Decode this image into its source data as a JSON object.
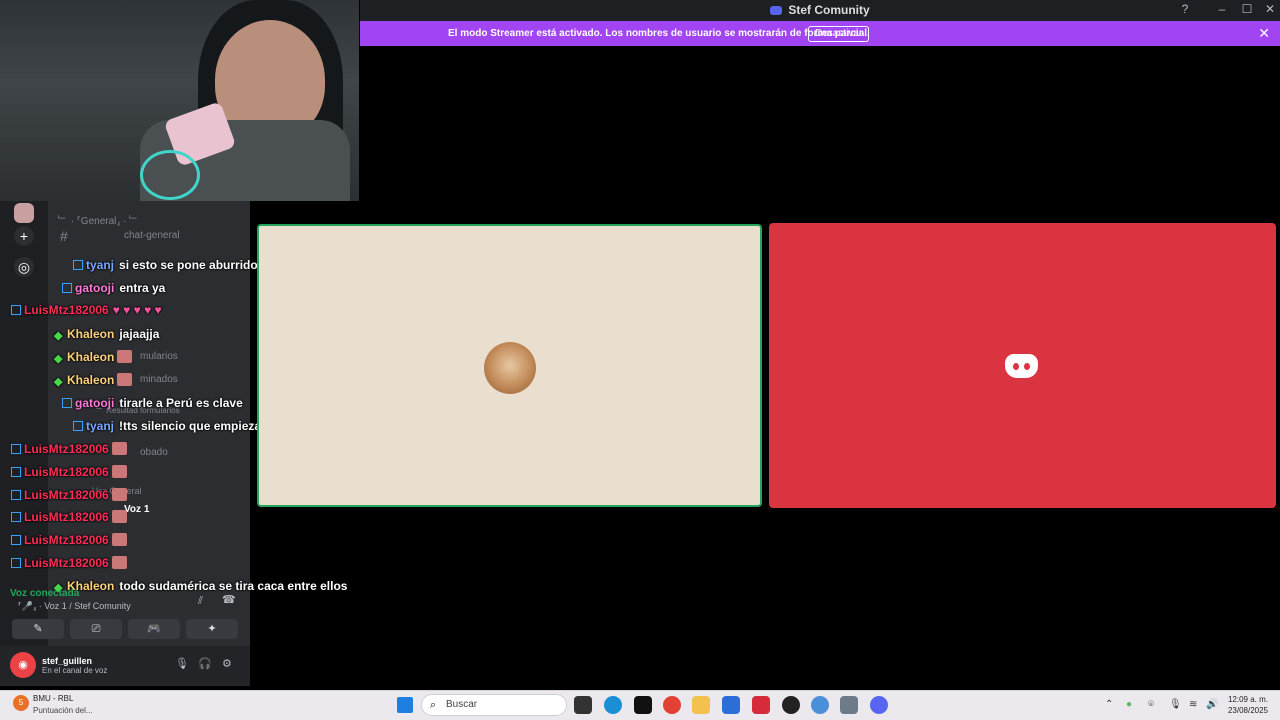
{
  "window": {
    "title": "Stef Comunity",
    "help": "?",
    "minimize": "–",
    "maximize": "☐",
    "close": "✕"
  },
  "banner": {
    "text": "El modo Streamer está activado. Los nombres de usuario se mostrarán de forma parcial.",
    "button": "Desactivar",
    "close": "✕"
  },
  "sidebar": {
    "category": "﹂ · ⸢General⸥ · ﹂",
    "channel": "chat-general",
    "faded_items": [
      "mularios",
      "minados",
      "obado",
      "﹂ Resultad formularios",
      "Voz General",
      "Voz 1"
    ]
  },
  "chat": [
    {
      "user": "tyanj",
      "color": "#7aa6ff",
      "badge": "blue",
      "msg": "si esto se pone aburrido me voy a meter :v"
    },
    {
      "user": "gatooji",
      "color": "#ff7ad9",
      "badge": "blue",
      "msg": "entra ya"
    },
    {
      "user": "LuisMtz182006",
      "color": "#ff2d55",
      "badge": "blue",
      "msg": "",
      "hearts": "♥ ♥ ♥ ♥ ♥"
    },
    {
      "user": "Khaleon",
      "color": "#ffd27a",
      "badge": "green",
      "msg": "jajaajja"
    },
    {
      "user": "Khaleon",
      "color": "#ffd27a",
      "badge": "green",
      "msg": ""
    },
    {
      "user": "Khaleon",
      "color": "#ffd27a",
      "badge": "green",
      "msg": ""
    },
    {
      "user": "gatooji",
      "color": "#ff7ad9",
      "badge": "blue",
      "msg": "tirarle a Perú es clave"
    },
    {
      "user": "tyanj",
      "color": "#7aa6ff",
      "badge": "blue",
      "msg": "!tts silencio que empieza mi novela xdxd"
    },
    {
      "user": "LuisMtz182006",
      "color": "#ff2d55",
      "badge": "blue",
      "msg": ""
    },
    {
      "user": "LuisMtz182006",
      "color": "#ff2d55",
      "badge": "blue",
      "msg": ""
    },
    {
      "user": "LuisMtz182006",
      "color": "#ff2d55",
      "badge": "blue",
      "msg": ""
    },
    {
      "user": "LuisMtz182006",
      "color": "#ff2d55",
      "badge": "blue",
      "msg": ""
    },
    {
      "user": "LuisMtz182006",
      "color": "#ff2d55",
      "badge": "blue",
      "msg": ""
    },
    {
      "user": "LuisMtz182006",
      "color": "#ff2d55",
      "badge": "blue",
      "msg": ""
    },
    {
      "user": "Khaleon",
      "color": "#ffd27a",
      "badge": "green",
      "msg": "todo sudamérica se tira caca entre ellos"
    }
  ],
  "voice": {
    "status": "Voz conectada",
    "channel": "⸢🎤⸥ · Voz 1 / Stef Comunity",
    "buttons": [
      "✎",
      "⎚",
      "🎮",
      "✦"
    ]
  },
  "user": {
    "name": "stef_guillen",
    "status": "En el canal de voz",
    "mic": "🎙",
    "headset": "🎧",
    "settings": "⚙"
  },
  "taskbar": {
    "weather_title": "BMU - RBL",
    "weather_sub": "Puntuación del...",
    "badge": "5",
    "search": "Buscar",
    "time": "12:09 a. m.",
    "date": "23/08/2025"
  },
  "colors": {
    "banner": "#a144f1",
    "tile_right": "#da3441",
    "tile_left": "#eadfcf",
    "speaking_border": "#23a55a"
  }
}
